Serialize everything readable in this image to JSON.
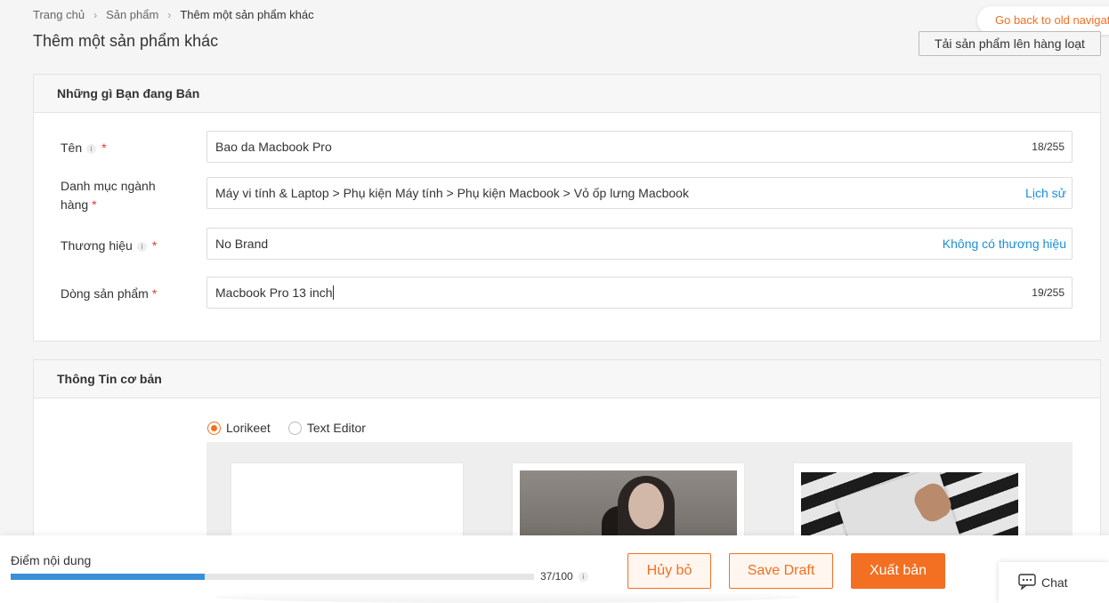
{
  "breadcrumb": {
    "home": "Trang chủ",
    "products": "Sản phẩm",
    "current": "Thêm một sản phẩm khác"
  },
  "page_title": "Thêm một sản phẩm khác",
  "go_back": "Go back to old navigati",
  "bulk_upload": "Tải sản phẩm lên hàng loạt",
  "section1": {
    "title": "Những gì Bạn đang Bán",
    "name": {
      "label": "Tên",
      "value": "Bao da Macbook Pro",
      "counter": "18/255"
    },
    "category": {
      "label_line1": "Danh mục ngành",
      "label_line2": "hàng",
      "value": "Máy vi tính & Laptop > Phụ kiện Máy tính > Phụ kiện Macbook > Vỏ ốp lưng Macbook",
      "link": "Lịch sử"
    },
    "brand": {
      "label": "Thương hiệu",
      "value": "No Brand",
      "link": "Không có thương hiệu"
    },
    "model": {
      "label": "Dòng sản phẩm",
      "value": "Macbook Pro 13 inch",
      "counter": "19/255"
    }
  },
  "section2": {
    "title": "Thông Tin cơ bản",
    "editor_options": [
      "Lorikeet",
      "Text Editor"
    ],
    "selected_editor": "Lorikeet"
  },
  "footer": {
    "score_label": "Điểm nội dung",
    "score_value": 37,
    "score_max": 100,
    "score_text": "37/100",
    "cancel": "Hủy bỏ",
    "save_draft": "Save Draft",
    "publish": "Xuất bản",
    "chat": "Chat"
  },
  "colors": {
    "accent": "#f36f21",
    "link": "#1a8fdc",
    "progress": "#3b8ed8",
    "required": "#e4393c"
  },
  "icons": [
    "chevron-right-icon",
    "info-icon",
    "chat-icon"
  ]
}
